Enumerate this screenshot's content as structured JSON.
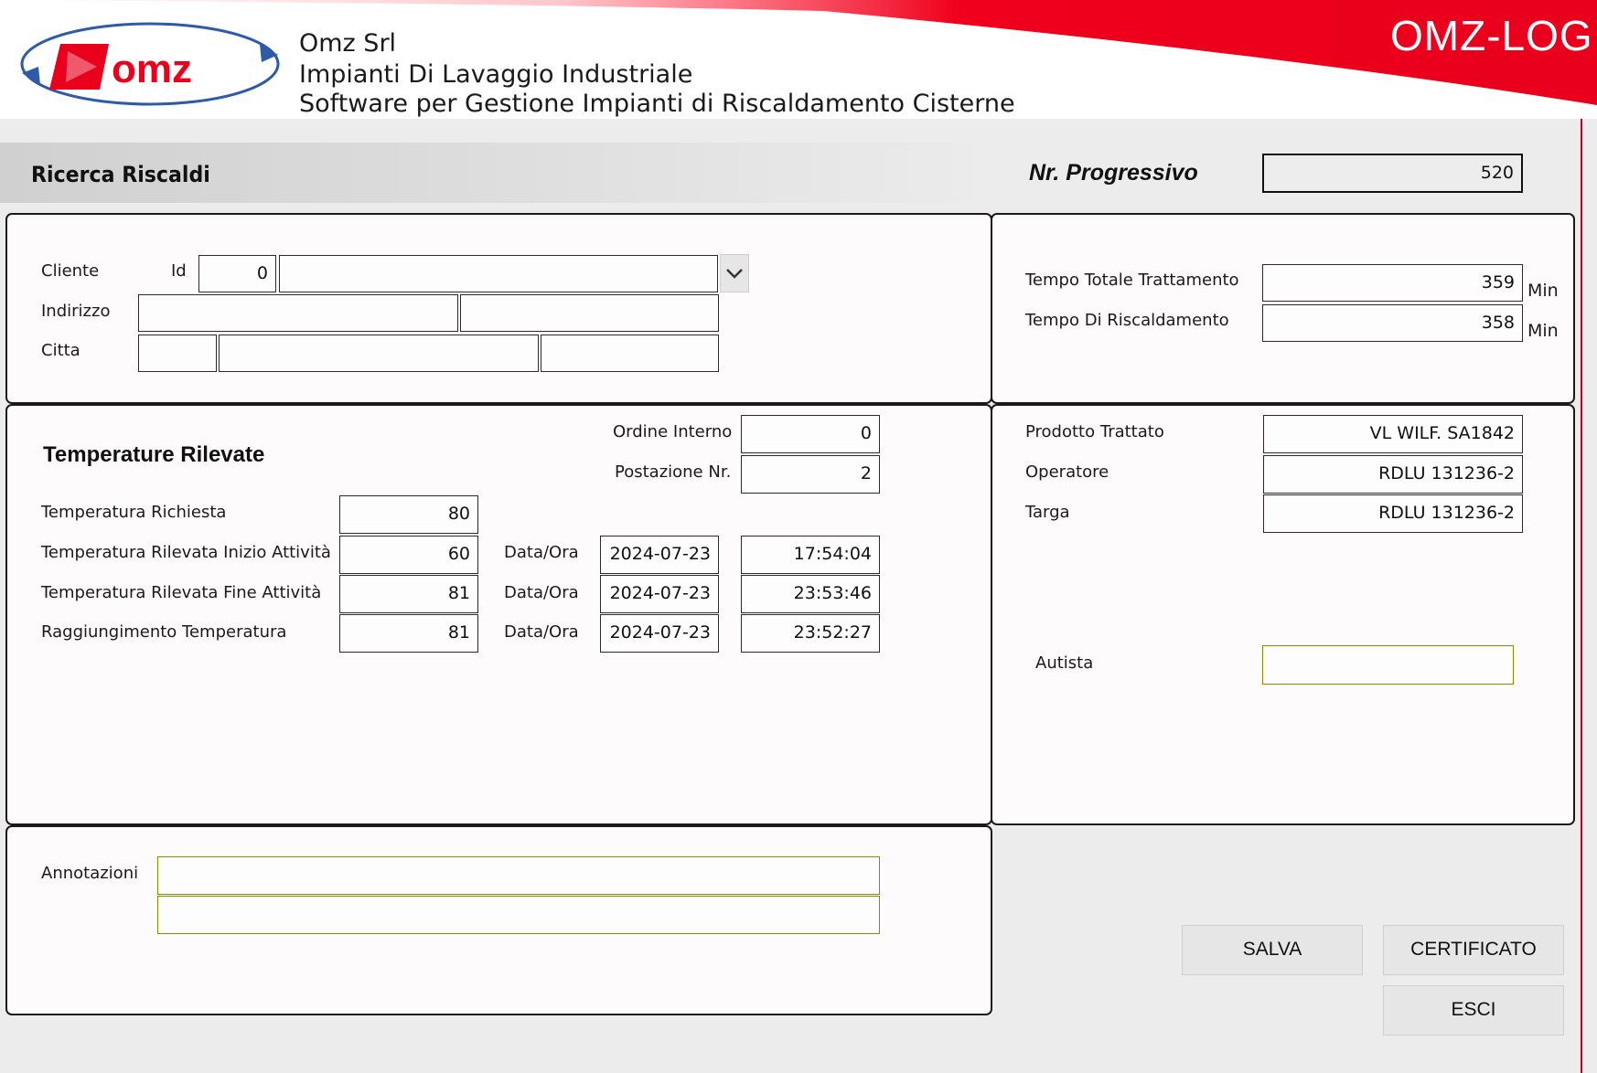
{
  "header": {
    "company_name": "Omz Srl",
    "company_line2": "Impianti Di Lavaggio Industriale",
    "company_line3": "Software per Gestione Impianti di Riscaldamento Cisterne",
    "app_title": "OMZ-LOG",
    "logo_text": "omz"
  },
  "page": {
    "title": "Ricerca Riscaldi",
    "progressive_label": "Nr. Progressivo",
    "progressive_value": "520"
  },
  "cliente": {
    "cliente_label": "Cliente",
    "id_label": "Id",
    "id_value": "0",
    "name_value": "",
    "indirizzo_label": "Indirizzo",
    "indirizzo_1": "",
    "indirizzo_2": "",
    "citta_label": "Citta",
    "citta_1": "",
    "citta_2": "",
    "citta_3": ""
  },
  "tempi": {
    "totale_label": "Tempo Totale Trattamento",
    "totale_value": "359",
    "riscaldamento_label": "Tempo Di Riscaldamento",
    "riscaldamento_value": "358",
    "unit": "Min"
  },
  "temperature": {
    "section_title": "Temperature Rilevate",
    "ordine_label": "Ordine Interno",
    "ordine_value": "0",
    "postazione_label": "Postazione Nr.",
    "postazione_value": "2",
    "dataora_label": "Data/Ora",
    "rows": [
      {
        "label": "Temperatura Richiesta",
        "value": "80",
        "date": "",
        "time": ""
      },
      {
        "label": "Temperatura Rilevata Inizio Attività",
        "value": "60",
        "date": "2024-07-23",
        "time": "17:54:04"
      },
      {
        "label": "Temperatura Rilevata Fine Attività",
        "value": "81",
        "date": "2024-07-23",
        "time": "23:53:46"
      },
      {
        "label": "Raggiungimento Temperatura",
        "value": "81",
        "date": "2024-07-23",
        "time": "23:52:27"
      }
    ]
  },
  "prodotto": {
    "prodotto_label": "Prodotto Trattato",
    "prodotto_value": "VL WILF. SA1842",
    "operatore_label": "Operatore",
    "operatore_value": "RDLU 131236-2",
    "targa_label": "Targa",
    "targa_value": "RDLU 131236-2",
    "autista_label": "Autista",
    "autista_value": ""
  },
  "annotazioni": {
    "label": "Annotazioni",
    "line1": "",
    "line2": ""
  },
  "buttons": {
    "salva": "SALVA",
    "certificato": "CERTIFICATO",
    "esci": "ESCI"
  },
  "colors": {
    "brand_red": "#e8001c",
    "field_yellow_border": "#8a8a00"
  }
}
